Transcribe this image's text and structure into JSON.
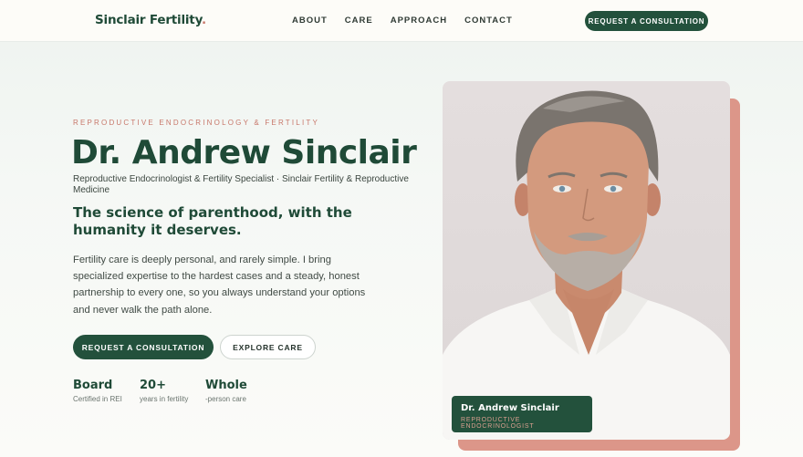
{
  "nav": {
    "brand": "Sinclair Fertility",
    "brand_dot": ".",
    "links": [
      "ABOUT",
      "CARE",
      "APPROACH",
      "CONTACT"
    ],
    "cta": "REQUEST A CONSULTATION"
  },
  "hero": {
    "eyebrow": "REPRODUCTIVE ENDOCRINOLOGY & FERTILITY",
    "name": "Dr. Andrew Sinclair",
    "subtitle": "Reproductive Endocrinologist & Fertility Specialist · Sinclair Fertility & Reproductive Medicine",
    "tagline": "The science of parenthood, with the humanity it deserves.",
    "lead": "Fertility care is deeply personal, and rarely simple. I bring specialized expertise to the hardest cases and a steady, honest partnership to every one, so you always understand your options and never walk the path alone.",
    "primary_cta": "REQUEST A CONSULTATION",
    "secondary_cta": "EXPLORE CARE",
    "stats": [
      {
        "value": "Board",
        "label": "Certified in REI"
      },
      {
        "value": "20+",
        "label": "years in fertility"
      },
      {
        "value": "Whole",
        "label": "-person care"
      }
    ]
  },
  "portrait": {
    "caption_name": "Dr. Andrew Sinclair",
    "caption_title": "REPRODUCTIVE ENDOCRINOLOGIST"
  },
  "colors": {
    "brand_green": "#23513c",
    "accent_coral": "#dc9689",
    "eyebrow_coral": "#c8776a"
  }
}
